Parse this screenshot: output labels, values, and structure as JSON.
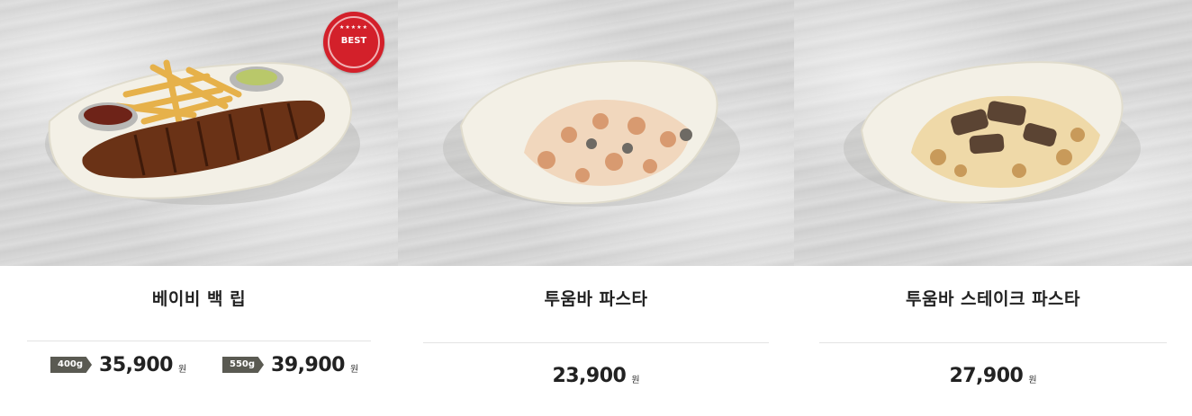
{
  "menu_items": [
    {
      "name": "베이비 백 립",
      "badge": "BEST",
      "badge_stars": "★★★★★",
      "prices": [
        {
          "size": "400g",
          "amount": "35,900",
          "unit": "원"
        },
        {
          "size": "550g",
          "amount": "39,900",
          "unit": "원"
        }
      ]
    },
    {
      "name": "투움바 파스타",
      "prices": [
        {
          "amount": "23,900",
          "unit": "원"
        }
      ]
    },
    {
      "name": "투움바 스테이크 파스타",
      "prices": [
        {
          "amount": "27,900",
          "unit": "원"
        }
      ]
    }
  ],
  "colors": {
    "badge_red": "#d3202a",
    "size_tag": "#5a5a52",
    "divider": "#e3e3e3"
  }
}
